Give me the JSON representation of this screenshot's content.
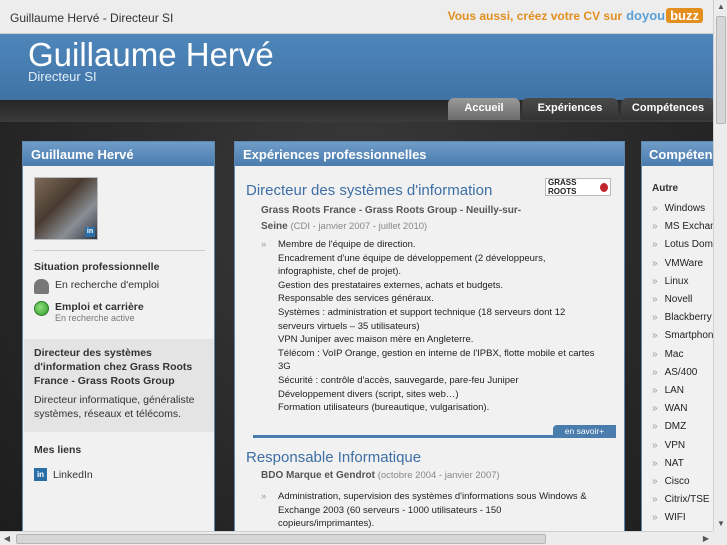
{
  "topbar": {
    "title": "Guillaume Hervé - Directeur SI",
    "promo": "Vous aussi, créez votre CV sur",
    "logo_do": "doyou",
    "logo_buzz": "buzz"
  },
  "header": {
    "name": "Guillaume Hervé",
    "role": "Directeur SI"
  },
  "tabs": [
    {
      "label": "Accueil",
      "active": true
    },
    {
      "label": "Expériences"
    },
    {
      "label": "Compétences"
    }
  ],
  "profile": {
    "heading": "Guillaume Hervé",
    "photo_badge": "in",
    "situation_title": "Situation professionnelle",
    "status1": "En recherche d'emploi",
    "status2_title": "Emploi et carrière",
    "status2_sub": "En recherche active",
    "current_title": "Directeur des systèmes d'information chez Grass Roots France - Grass Roots Group",
    "summary": "Directeur informatique, généraliste systèmes, réseaux et télécoms.",
    "links_title": "Mes liens",
    "link_icon": "in",
    "link_linkedin": "LinkedIn"
  },
  "experiences": {
    "heading": "Expériences professionnelles",
    "job1": {
      "title": "Directeur des systèmes d'information",
      "company_l1": "Grass Roots France - Grass Roots Group - Neuilly-sur-",
      "company_l2": "Seine",
      "dates": "(CDI - janvier 2007 - juillet 2010)",
      "logo_text": "GRASS ROOTS",
      "lines": [
        "Membre de l'équipe de direction.",
        "Encadrement d'une équipe de développement (2 développeurs,",
        "infographiste, chef de projet).",
        "Gestion des prestataires externes, achats et budgets.",
        "Responsable des services généraux.",
        "Systèmes : administration et support technique (18 serveurs dont 12",
        "serveurs virtuels – 35 utilisateurs)",
        "VPN Juniper avec maison mère en Angleterre.",
        "Télécom : VoIP Orange, gestion en interne de l'IPBX, flotte mobile et cartes",
        "3G",
        "Sécurité : contrôle d'accès, sauvegarde, pare-feu Juniper",
        "Développement divers (script, sites web…)",
        "Formation utilisateurs (bureautique, vulgarisation)."
      ],
      "more": "en savoir+"
    },
    "job2": {
      "title": "Responsable Informatique",
      "company": "BDO Marque et Gendrot",
      "dates": "(octobre 2004 - janvier 2007)",
      "lines": [
        "Administration, supervision des systèmes d'informations sous Windows &",
        "Exchange 2003 (60 serveurs - 1000 utilisateurs - 150",
        "copieurs/imprimantes)."
      ]
    }
  },
  "skills": {
    "heading": "Compétences",
    "group": "Autre",
    "items": [
      "Windows",
      "MS Exchange",
      "Lotus Domino",
      "VMWare",
      "Linux",
      "Novell",
      "Blackberry",
      "Smartphone",
      "Mac",
      "AS/400",
      "LAN",
      "WAN",
      "DMZ",
      "VPN",
      "NAT",
      "Cisco",
      "Citrix/TSE",
      "WIFI"
    ]
  }
}
